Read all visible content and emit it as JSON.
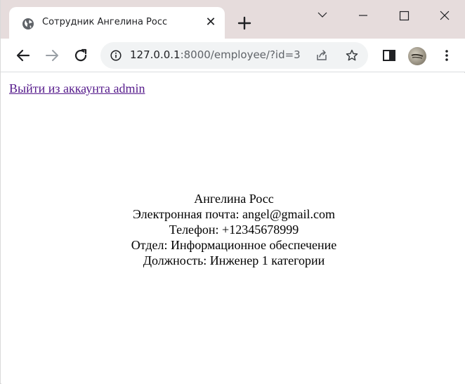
{
  "browser": {
    "tab": {
      "title": "Сотрудник Ангелина Росс",
      "close_glyph": "✕",
      "favicon": "globe-icon"
    },
    "url": {
      "host": "127.0.0.1",
      "rest": ":8000/employee/?id=3"
    }
  },
  "page": {
    "logout_link": "Выйти из аккаунта admin",
    "employee": {
      "name": "Ангелина Росс",
      "email": "Электронная почта: angel@gmail.com",
      "phone": "Телефон: +12345678999",
      "department": "Отдел: Информационное обеспечение",
      "position": "Должность: Инженер 1 категории"
    }
  }
}
